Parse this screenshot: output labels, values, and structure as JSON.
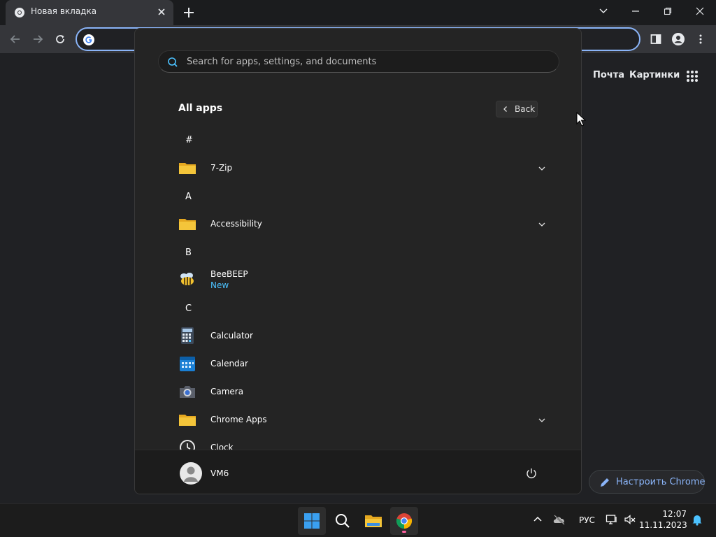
{
  "browser": {
    "tab_title": "Новая вкладка",
    "ntp_links": {
      "mail": "Почта",
      "images": "Картинки"
    },
    "customize_label": "Настроить Chrome"
  },
  "start_menu": {
    "search_placeholder": "Search for apps, settings, and documents",
    "all_apps_title": "All apps",
    "back_label": "Back",
    "letters": {
      "hash": "#",
      "a": "A",
      "b": "B",
      "c": "C"
    },
    "apps": [
      {
        "name": "7-Zip",
        "icon": "folder-icon",
        "expandable": true
      },
      {
        "name": "Accessibility",
        "icon": "folder-icon",
        "expandable": true
      },
      {
        "name": "BeeBEEP",
        "icon": "bee-icon",
        "badge": "New"
      },
      {
        "name": "Calculator",
        "icon": "calculator-icon"
      },
      {
        "name": "Calendar",
        "icon": "calendar-icon"
      },
      {
        "name": "Camera",
        "icon": "camera-icon"
      },
      {
        "name": "Chrome Apps",
        "icon": "folder-icon",
        "expandable": true
      },
      {
        "name": "Clock",
        "icon": "clock-icon"
      }
    ],
    "user_name": "VM6"
  },
  "taskbar": {
    "language": "РУС",
    "time": "12:07",
    "date": "11.11.2023"
  },
  "colors": {
    "accent_blue": "#8ab4f8",
    "new_badge": "#4cc2ff",
    "folder": "#f4c53a"
  }
}
